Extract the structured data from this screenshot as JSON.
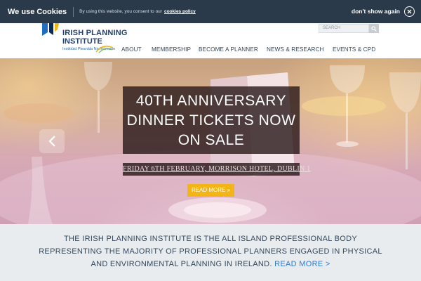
{
  "cookie_bar": {
    "title": "We use Cookies",
    "text": "By using this website, you consent to our",
    "link": "cookies policy",
    "dismiss": "don't show again"
  },
  "header": {
    "logo": {
      "line1": "IRISH PLANNING",
      "line2": "INSTITUTE",
      "subtitle": "Institiúid Pleanála Na hÉireann"
    },
    "search_placeholder": "SEARCH",
    "nav": [
      "ABOUT",
      "MEMBERSHIP",
      "BECOME A PLANNER",
      "NEWS & RESEARCH",
      "EVENTS & CPD"
    ]
  },
  "hero": {
    "title_lines": [
      "40TH ANNIVERSARY",
      "DINNER TICKETS NOW",
      "ON SALE"
    ],
    "subtitle": "FRIDAY 6TH FEBRUARY, MORRISON HOTEL, DUBLIN 1",
    "button": "READ MORE »"
  },
  "intro": {
    "lines": [
      "THE IRISH PLANNING INSTITUTE IS THE ALL ISLAND PROFESSIONAL BODY",
      "REPRESENTING THE MAJORITY OF PROFESSIONAL PLANNERS ENGAGED IN PHYSICAL",
      "AND ENVIRONMENTAL PLANNING IN IRELAND."
    ],
    "link": "READ MORE >"
  },
  "colors": {
    "cookie_bar": "#2a3a4a",
    "brand_navy": "#233f70",
    "accent_yellow": "#f3b515",
    "link_blue": "#2a7dd4"
  },
  "icons": [
    "close-icon",
    "search-icon",
    "chevron-left-icon"
  ]
}
